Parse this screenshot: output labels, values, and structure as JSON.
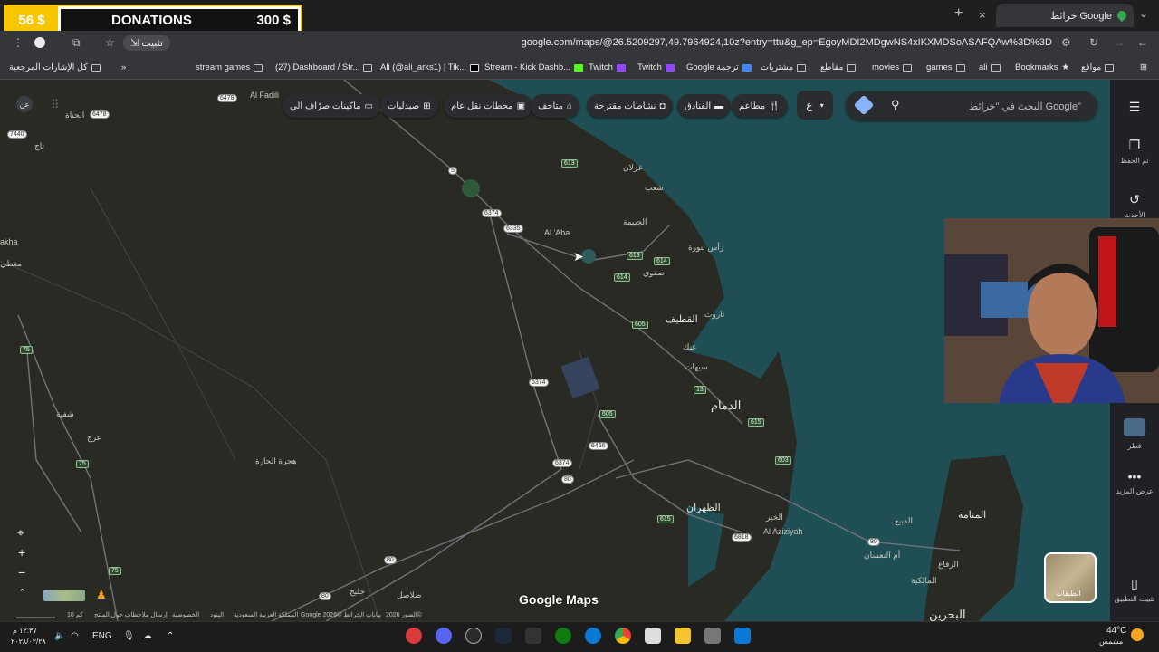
{
  "browser": {
    "tab_title": "خرائط Google",
    "tab_close": "×",
    "new_tab": "+",
    "tab_menu": "⌄",
    "min_glyph": "–",
    "url": "google.com/maps/@26.5209297,49.7964924,10z?entry=ttu&g_ep=EgoyMDI2MDgwNS4xIKXMDSoASAFQAw%3D%3D",
    "install_label": "تثبيت",
    "bookmarks": [
      {
        "label": "مواقع",
        "icon": "folder-icon"
      },
      {
        "label": "Bookmarks",
        "icon": "star-icon"
      },
      {
        "label": "ali",
        "icon": "folder-icon"
      },
      {
        "label": "games",
        "icon": "folder-icon"
      },
      {
        "label": "movies",
        "icon": "folder-icon"
      },
      {
        "label": "مقاطع",
        "icon": "folder-icon"
      },
      {
        "label": "مشتريات",
        "icon": "folder-icon"
      },
      {
        "label": "Google ترجمة",
        "icon": "translate-icon"
      },
      {
        "label": "Twitch",
        "icon": "twitch-icon"
      },
      {
        "label": "Twitch",
        "icon": "twitch-icon"
      },
      {
        "label": "Stream - Kick Dashb...",
        "icon": "kick-icon"
      },
      {
        "label": "Ali (@ali_arks1) | Tik...",
        "icon": "tiktok-icon"
      },
      {
        "label": "(27) Dashboard / Str...",
        "icon": "folder-icon"
      },
      {
        "label": "stream games",
        "icon": "folder-icon"
      }
    ],
    "all_bookmarks": "كل الإشارات المرجعية"
  },
  "donations": {
    "amount_left": "56 $",
    "title": "DONATIONS",
    "amount_right": "300 $"
  },
  "maps": {
    "search_placeholder": "البحث في \"خرائط Google\"",
    "lang_label": "ع",
    "chips": [
      {
        "label": "مطاعم",
        "icon": "restaurant-icon"
      },
      {
        "label": "الفنادق",
        "icon": "hotel-icon"
      },
      {
        "label": "نشاطات مقترحة",
        "icon": "camera-icon"
      },
      {
        "label": "متاحف",
        "icon": "museum-icon"
      },
      {
        "label": "محطات نقل عام",
        "icon": "transit-icon"
      },
      {
        "label": "صيدليات",
        "icon": "pharmacy-icon"
      },
      {
        "label": "ماكينات صرّاف آلي",
        "icon": "atm-icon"
      }
    ],
    "sidebar": [
      {
        "label": "تم الحفظ",
        "icon": "bookmark-icon"
      },
      {
        "label": "الأحدث",
        "icon": "history-icon"
      },
      {
        "label": "قطر",
        "icon": "thumbnail-icon"
      },
      {
        "label": "عرض المزيد",
        "icon": "more-icon"
      },
      {
        "label": "تثبيت التطبيق",
        "icon": "phone-icon"
      }
    ],
    "layers_label": "الطبقات",
    "logo": "Google Maps",
    "scale": "10 كم",
    "footer": [
      "إرسال ملاحظات حول المنتج",
      "الخصوصية",
      "البنود",
      "المملكة العربية السعودية",
      "Google 2026© بيانات الخرائط",
      "الصور 2026©"
    ],
    "places": [
      {
        "label": "Al Fadili"
      },
      {
        "label": "الحناة"
      },
      {
        "label": "تاج"
      },
      {
        "label": "akha"
      },
      {
        "label": "مغطي"
      },
      {
        "label": "غزلان"
      },
      {
        "label": "شعب"
      },
      {
        "label": "الجبيمة"
      },
      {
        "label": "Al 'Aba"
      },
      {
        "label": "رأس تنورة"
      },
      {
        "label": "صفوي"
      },
      {
        "label": "القطيف"
      },
      {
        "label": "تاروت"
      },
      {
        "label": "عنك"
      },
      {
        "label": "سيهات"
      },
      {
        "label": "الدمام"
      },
      {
        "label": "شفية"
      },
      {
        "label": "عرج"
      },
      {
        "label": "هجرة الحارة"
      },
      {
        "label": "الظهران"
      },
      {
        "label": "الخبر"
      },
      {
        "label": "Al Aziziyah"
      },
      {
        "label": "المنامة"
      },
      {
        "label": "المالكية"
      },
      {
        "label": "الرفاع"
      },
      {
        "label": "أم النعسان"
      },
      {
        "label": "البحرين"
      },
      {
        "label": "صلاصل"
      },
      {
        "label": "جليج"
      },
      {
        "label": "الدبيع"
      }
    ],
    "shields": [
      "6478",
      "6478",
      "7440",
      "5",
      "6374",
      "6335",
      "613",
      "613",
      "614",
      "614",
      "605",
      "75",
      "6374",
      "605",
      "6466",
      "6374",
      "80",
      "615",
      "6818",
      "615",
      "603",
      "75",
      "80",
      "80",
      "80",
      "75",
      "13"
    ]
  },
  "taskbar": {
    "lang": "ENG",
    "time": "١٢:٣٧ م",
    "date": "٢٠٢٨/٠٢/٢٨",
    "temp": "44°C",
    "weather": "مشمس"
  }
}
